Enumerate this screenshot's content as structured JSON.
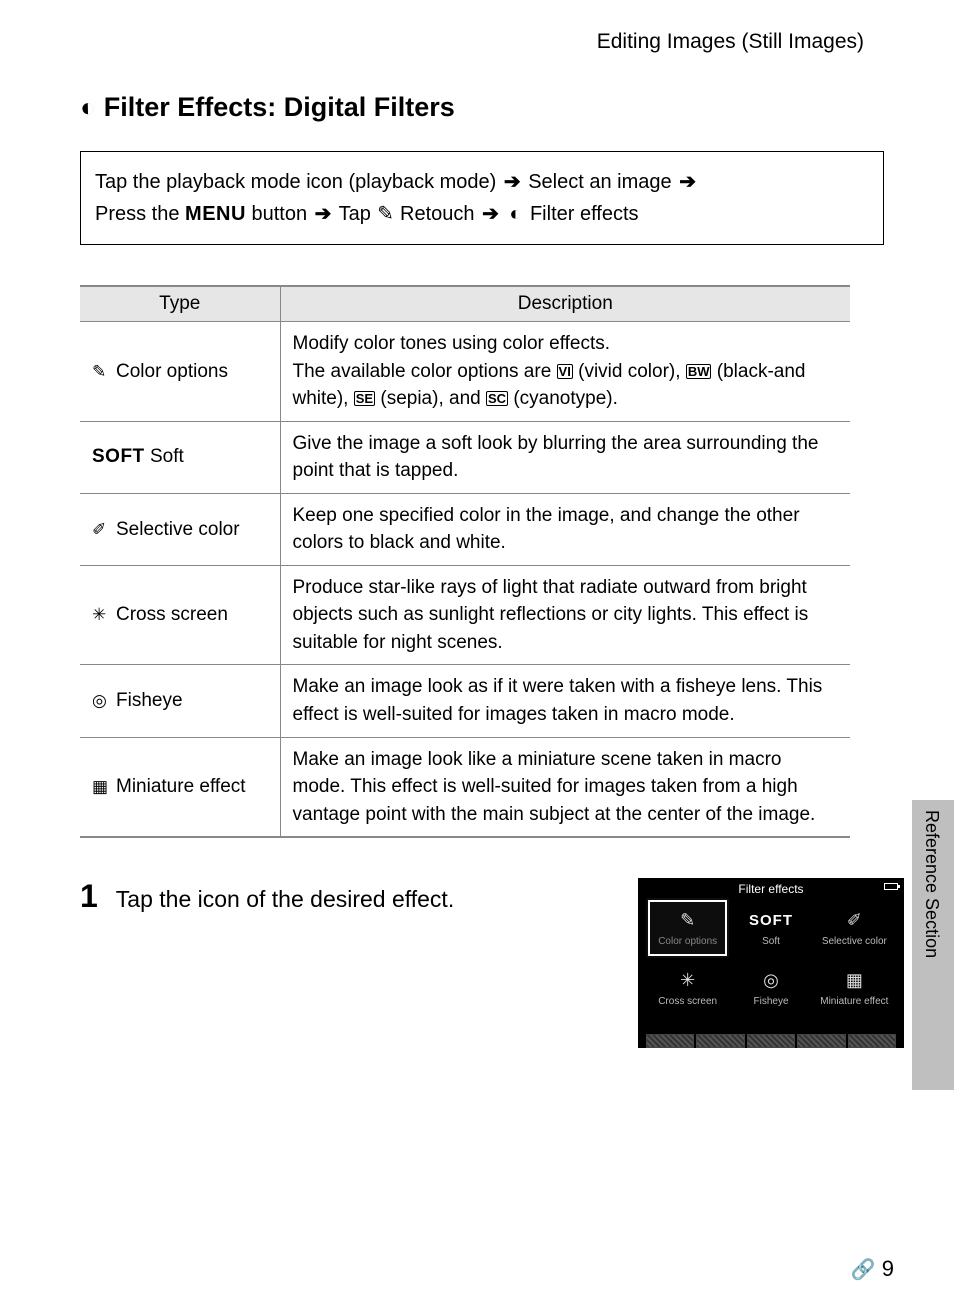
{
  "header": "Editing Images (Still Images)",
  "title": "Filter Effects: Digital Filters",
  "nav": {
    "part1": "Tap the playback mode icon (playback mode)",
    "part2": "Select an image",
    "part3a": "Press the ",
    "menu": "MENU",
    "part3b": " button",
    "part4": "Tap",
    "retouch": "Retouch",
    "filter": "Filter effects"
  },
  "table": {
    "h1": "Type",
    "h2": "Description",
    "rows": [
      {
        "type": "Color options",
        "desc_pre": "Modify color tones using color effects.\nThe available color options are ",
        "opt1": "(vivid color), ",
        "opt2": "(black-and white), ",
        "opt3": "(sepia), and ",
        "opt4": "(cyanotype)."
      },
      {
        "type": "Soft",
        "desc": "Give the image a soft look by blurring the area surrounding the point that is tapped."
      },
      {
        "type": "Selective color",
        "desc": "Keep one specified color in the image, and change the other colors to black and white."
      },
      {
        "type": "Cross screen",
        "desc": "Produce star-like rays of light that radiate outward from bright objects such as sunlight reflections or city lights. This effect is suitable for night scenes."
      },
      {
        "type": "Fisheye",
        "desc": "Make an image look as if it were taken with a fisheye lens. This effect is well-suited for images taken in macro mode."
      },
      {
        "type": "Miniature effect",
        "desc": "Make an image look like a miniature scene taken in macro mode. This effect is well-suited for images taken from a high vantage point with the main subject at the center of the image."
      }
    ]
  },
  "step": {
    "num": "1",
    "text": "Tap the icon of the desired effect."
  },
  "screen": {
    "title": "Filter effects",
    "cells": [
      {
        "label": "Color options"
      },
      {
        "label": "Soft"
      },
      {
        "label": "Selective color"
      },
      {
        "label": "Cross screen"
      },
      {
        "label": "Fisheye"
      },
      {
        "label": "Miniature effect"
      }
    ]
  },
  "side": "Reference Section",
  "pagenum": "9"
}
